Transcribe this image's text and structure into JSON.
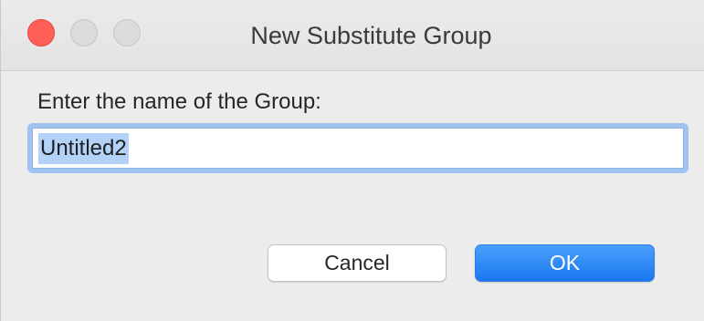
{
  "window": {
    "title": "New Substitute Group"
  },
  "dialog": {
    "prompt": "Enter the name of the Group:",
    "name_field": {
      "value": "Untitled2",
      "selected": true
    },
    "buttons": {
      "cancel_label": "Cancel",
      "ok_label": "OK"
    }
  },
  "icons": {
    "close": "close-traffic-light",
    "minimize": "minimize-traffic-light",
    "zoom": "zoom-traffic-light"
  },
  "colors": {
    "close_button": "#fe5f57",
    "inactive_traffic": "#dcdcdc",
    "accent": "#1a77f0",
    "selection": "#b3d2f8",
    "focus_ring": "#9fc2ee"
  }
}
